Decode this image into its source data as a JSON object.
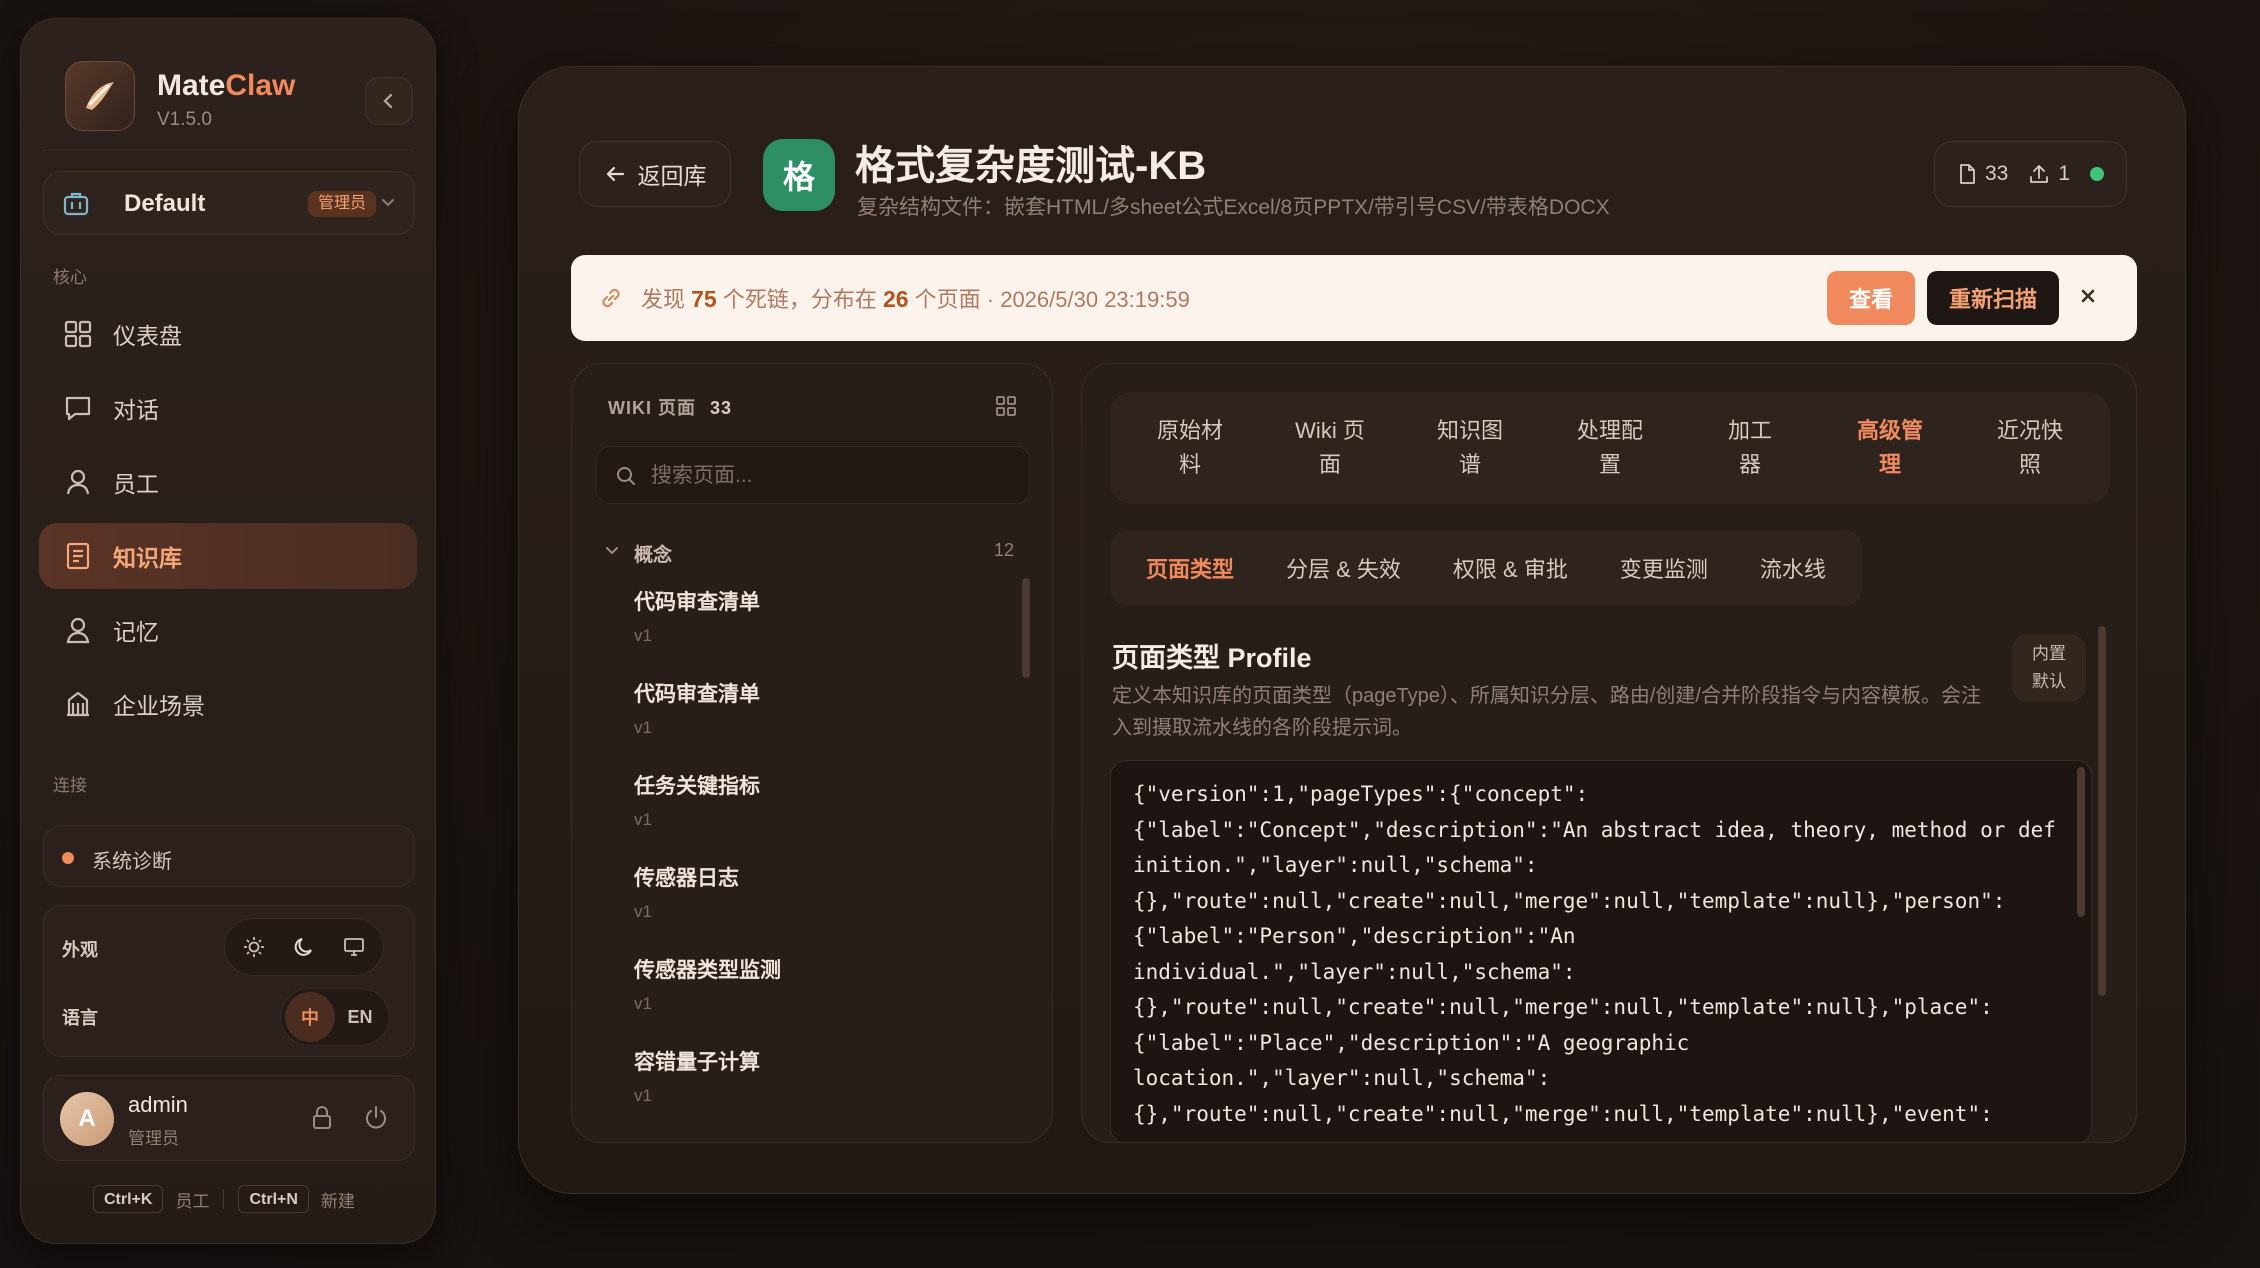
{
  "sidebar": {
    "brand": {
      "name_part1": "Mate",
      "name_part2": "Claw",
      "version": "V1.5.0"
    },
    "workspace": {
      "name": "Default",
      "badge": "管理员"
    },
    "section_core": "核心",
    "section_connect": "连接",
    "nav": [
      {
        "label": "仪表盘",
        "icon": "dashboard-icon"
      },
      {
        "label": "对话",
        "icon": "chat-icon"
      },
      {
        "label": "员工",
        "icon": "user-icon"
      },
      {
        "label": "知识库",
        "icon": "knowledge-icon",
        "active": true
      },
      {
        "label": "记忆",
        "icon": "memory-icon"
      },
      {
        "label": "企业场景",
        "icon": "building-icon"
      }
    ],
    "diagnostics": "系统诊断",
    "appearance_label": "外观",
    "language_label": "语言",
    "language_options": [
      "中",
      "EN"
    ],
    "user": {
      "initial": "A",
      "name": "admin",
      "role": "管理员"
    },
    "shortcuts": [
      {
        "key": "Ctrl+K",
        "label": "员工"
      },
      {
        "key": "Ctrl+N",
        "label": "新建"
      }
    ]
  },
  "header": {
    "back_label": "返回库",
    "kb_initial": "格",
    "title": "格式复杂度测试-KB",
    "description": "复杂结构文件：嵌套HTML/多sheet公式Excel/8页PPTX/带引号CSV/带表格DOCX",
    "doc_count": "33",
    "upload_count": "1"
  },
  "alert": {
    "prefix": "发现 ",
    "dead_links": "75",
    "middle": " 个死链，分布在 ",
    "pages": "26",
    "suffix": " 个页面 · 2026/5/30 23:19:59",
    "view_label": "查看",
    "rescan_label": "重新扫描"
  },
  "wiki": {
    "header": "WIKI 页面",
    "count": "33",
    "search_placeholder": "搜索页面...",
    "group": {
      "name": "概念",
      "count": "12"
    },
    "pages": [
      {
        "name": "代码审查清单",
        "version": "v1"
      },
      {
        "name": "代码审查清单",
        "version": "v1"
      },
      {
        "name": "任务关键指标",
        "version": "v1"
      },
      {
        "name": "传感器日志",
        "version": "v1"
      },
      {
        "name": "传感器类型监测",
        "version": "v1"
      },
      {
        "name": "容错量子计算",
        "version": "v1"
      }
    ]
  },
  "content": {
    "top_tabs": [
      {
        "line1": "原始材",
        "line2": "料"
      },
      {
        "line1": "Wiki 页",
        "line2": "面"
      },
      {
        "line1": "知识图",
        "line2": "谱"
      },
      {
        "line1": "处理配",
        "line2": "置"
      },
      {
        "line1": "加工",
        "line2": "器"
      },
      {
        "line1": "高级管",
        "line2": "理",
        "selected": true
      },
      {
        "line1": "近况快",
        "line2": "照"
      }
    ],
    "sub_tabs": [
      {
        "label": "页面类型",
        "selected": true
      },
      {
        "label": "分层 & 失效"
      },
      {
        "label": "权限 & 审批"
      },
      {
        "label": "变更监测"
      },
      {
        "label": "流水线"
      }
    ],
    "section_title": "页面类型 Profile",
    "section_desc": "定义本知识库的页面类型（pageType）、所属知识分层、路由/创建/合并阶段指令与内容模板。会注入到摄取流水线的各阶段提示词。",
    "badge_line1": "内置",
    "badge_line2": "默认",
    "code": "{\"version\":1,\"pageTypes\":{\"concept\":\n{\"label\":\"Concept\",\"description\":\"An abstract idea, theory, method or definition.\",\"layer\":null,\"schema\":\n{},\"route\":null,\"create\":null,\"merge\":null,\"template\":null},\"person\":\n{\"label\":\"Person\",\"description\":\"An\nindividual.\",\"layer\":null,\"schema\":\n{},\"route\":null,\"create\":null,\"merge\":null,\"template\":null},\"place\":\n{\"label\":\"Place\",\"description\":\"A geographic\nlocation.\",\"layer\":null,\"schema\":\n{},\"route\":null,\"create\":null,\"merge\":null,\"template\":null},\"event\":"
  },
  "colors": {
    "accent": "#f08a5d",
    "kb_avatar": "#2f8f64",
    "status_ok": "#3fc47a"
  }
}
